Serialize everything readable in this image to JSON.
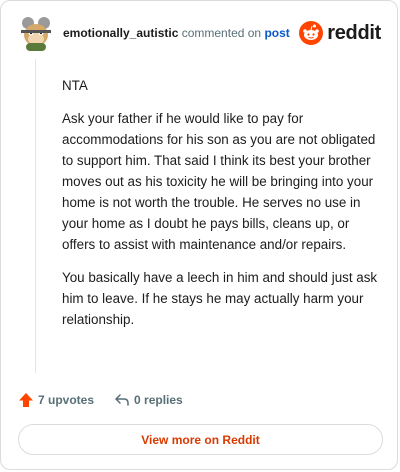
{
  "comment": {
    "username": "emotionally_autistic",
    "commented_on": "commented on",
    "post_link": "post",
    "paragraphs": [
      "NTA",
      "Ask your father if he would like to pay for accommodations for his son as you are not obligated to support him. That said I think its best your brother moves out as his toxicity he will be bringing into your home is not worth the trouble. He serves no use in your home as I doubt he pays bills, cleans up, or offers to assist with maintenance and/or repairs.",
      "You basically have a leech in him and should just ask him to leave. If he stays he may actually harm your relationship."
    ]
  },
  "brand": {
    "name": "reddit",
    "logo_icon": "reddit-logo-icon",
    "color": "#ff4500"
  },
  "actions": {
    "upvotes": "7 upvotes",
    "upvote_icon": "upvote-arrow-icon",
    "upvote_color": "#ff4500",
    "replies": "0 replies",
    "reply_icon": "reply-arrow-icon"
  },
  "footer": {
    "view_more": "View more on Reddit"
  }
}
